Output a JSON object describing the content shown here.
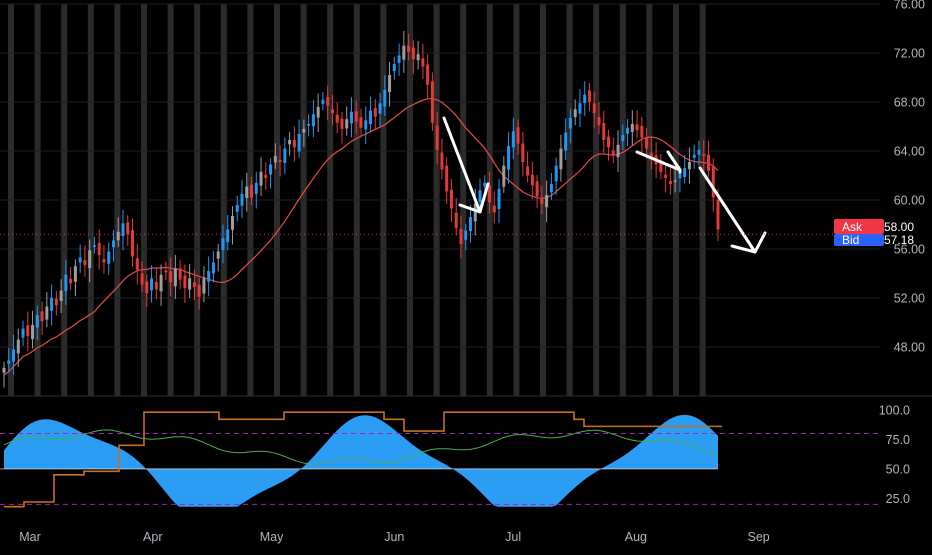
{
  "chart_data": {
    "type": "candlestick",
    "ylim": [
      44.0,
      76.0
    ],
    "yticks": [
      {
        "value": 76,
        "label": "76.00"
      },
      {
        "value": 72,
        "label": "72.00"
      },
      {
        "value": 68,
        "label": "68.00"
      },
      {
        "value": 64,
        "label": "64.00"
      },
      {
        "value": 60,
        "label": "60.00"
      },
      {
        "value": 56,
        "label": "56.00"
      },
      {
        "value": 52,
        "label": "52.00"
      },
      {
        "value": 48,
        "label": "48.00"
      }
    ],
    "xticks": [
      {
        "label": "Mar",
        "date": "2023-03-01"
      },
      {
        "label": "Apr",
        "date": "2023-04-01"
      },
      {
        "label": "May",
        "date": "2023-05-01"
      },
      {
        "label": "Jun",
        "date": "2023-06-01"
      },
      {
        "label": "Jul",
        "date": "2023-07-01"
      },
      {
        "label": "Aug",
        "date": "2023-08-01"
      },
      {
        "label": "Sep",
        "date": "2023-09-01"
      }
    ],
    "colors": {
      "background": "#000000",
      "up": "#2196f3",
      "up_alt": "#9e9e9e",
      "down": "#e53935",
      "moving_average": "#e84a4a",
      "stripe": "#3a3a3a",
      "oscillator_fill": "#2b9df4",
      "orange_line": "#c8701e",
      "green_line": "#4caf50",
      "reference_line": "#9c27b0",
      "annotation": "#ffffff",
      "ask": "#f23645",
      "bid": "#2962ff"
    },
    "quote": {
      "ask_label": "Ask",
      "ask_value": "58.00",
      "bid_label": "Bid",
      "bid_value": "57.18",
      "price_line": 57.2
    },
    "candles_close": [
      46.3,
      46.9,
      47.8,
      48.6,
      49.5,
      48.9,
      49.8,
      50.6,
      50.1,
      51.3,
      52.0,
      51.4,
      52.6,
      53.9,
      53.2,
      54.6,
      55.3,
      54.7,
      55.9,
      56.3,
      55.5,
      54.9,
      55.8,
      56.7,
      57.4,
      58.1,
      57.2,
      55.4,
      54.3,
      53.1,
      52.4,
      53.6,
      52.7,
      53.9,
      54.1,
      53.3,
      54.4,
      53.5,
      52.8,
      53.6,
      52.9,
      52.1,
      53.6,
      54.2,
      54.9,
      55.8,
      56.9,
      57.6,
      58.7,
      59.6,
      60.5,
      61.1,
      60.2,
      61.4,
      62.3,
      61.8,
      62.9,
      63.6,
      63.1,
      64.2,
      64.9,
      64.3,
      65.4,
      65.8,
      66.2,
      67.0,
      67.6,
      68.2,
      67.7,
      67.1,
      66.3,
      65.8,
      66.6,
      67.2,
      66.4,
      65.9,
      66.5,
      67.3,
      66.8,
      67.9,
      69.0,
      70.2,
      71.1,
      71.8,
      72.6,
      72.1,
      71.5,
      71.9,
      70.9,
      69.4,
      66.3,
      64.1,
      62.5,
      60.7,
      59.3,
      57.7,
      56.4,
      57.5,
      58.6,
      59.7,
      60.8,
      61.4,
      59.8,
      59.0,
      60.9,
      62.8,
      64.4,
      65.6,
      64.6,
      63.1,
      62.0,
      61.2,
      60.3,
      59.7,
      60.4,
      61.3,
      62.8,
      64.2,
      65.5,
      66.7,
      67.4,
      67.9,
      68.6,
      68.0,
      67.1,
      66.1,
      64.9,
      64.3,
      63.7,
      64.5,
      65.3,
      65.9,
      66.2,
      65.7,
      65.1,
      64.2,
      63.5,
      62.9,
      62.3,
      61.8,
      61.3,
      61.6,
      62.2,
      62.6,
      63.1,
      63.7,
      64.1,
      63.6,
      62.4,
      60.2,
      57.6
    ]
  },
  "oscillator": {
    "ticks": [
      {
        "value": 100,
        "label": "100.0"
      },
      {
        "value": 75,
        "label": "75.0"
      },
      {
        "value": 50,
        "label": "50.0"
      },
      {
        "value": 25,
        "label": "25.0"
      }
    ],
    "reference_levels": [
      80,
      20
    ],
    "baseline": 50
  }
}
